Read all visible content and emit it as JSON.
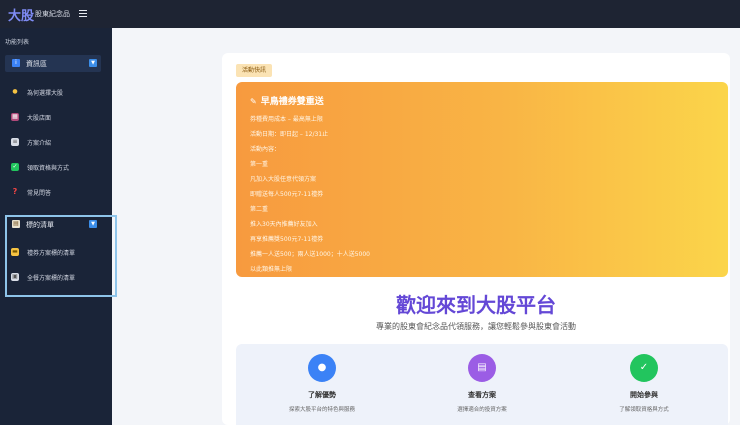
{
  "header": {
    "logo": "大股",
    "subtitle": "股東紀念品"
  },
  "sidebar": {
    "title": "功能列表",
    "group1": {
      "label": "資訊區",
      "icon": "info-icon"
    },
    "items": [
      {
        "label": "為何選擇大股",
        "icon": "lightbulb-icon"
      },
      {
        "label": "大股店面",
        "icon": "store-icon"
      },
      {
        "label": "方案介紹",
        "icon": "document-icon"
      },
      {
        "label": "領取資格與方式",
        "icon": "checkbox-icon"
      },
      {
        "label": "常見問答",
        "icon": "question-icon"
      }
    ],
    "group2": {
      "label": "標的清單",
      "icon": "clipboard-icon"
    },
    "group2_items": [
      {
        "label": "禮券方案標的清單",
        "icon": "ticket-icon"
      },
      {
        "label": "全餐方案標的清單",
        "icon": "meal-icon"
      }
    ]
  },
  "main": {
    "badge": "活動快訊",
    "promo": {
      "title": "早鳥禮券雙重送",
      "lines": [
        "券種費用成本 – 最高無上限",
        "活動日期：即日起 – 12/31止",
        "活動內容：",
        "第一重",
        "凡加入大股任意代領方案",
        "即贈送每人500元7-11禮券",
        "第二重",
        "推入30天內推薦好友加入",
        "再享推薦獎500元7-11禮券",
        "推薦一人送500；兩人送1000；十人送5000",
        "以此類推無上限"
      ]
    },
    "welcome": "歡迎來到大股平台",
    "subtitle": "專業的股東會紀念品代領服務，讓您輕鬆參與股東會活動",
    "features": [
      {
        "title": "了解優勢",
        "desc": "探索大股平台的特色與服務",
        "icon": "lightbulb-icon",
        "color": "#3b82f6"
      },
      {
        "title": "查看方案",
        "desc": "選擇適合的投資方案",
        "icon": "document-icon",
        "color": "#9b5de5"
      },
      {
        "title": "開始參與",
        "desc": "了解領取資格與方式",
        "icon": "checkbox-icon",
        "color": "#22c55e"
      }
    ]
  }
}
